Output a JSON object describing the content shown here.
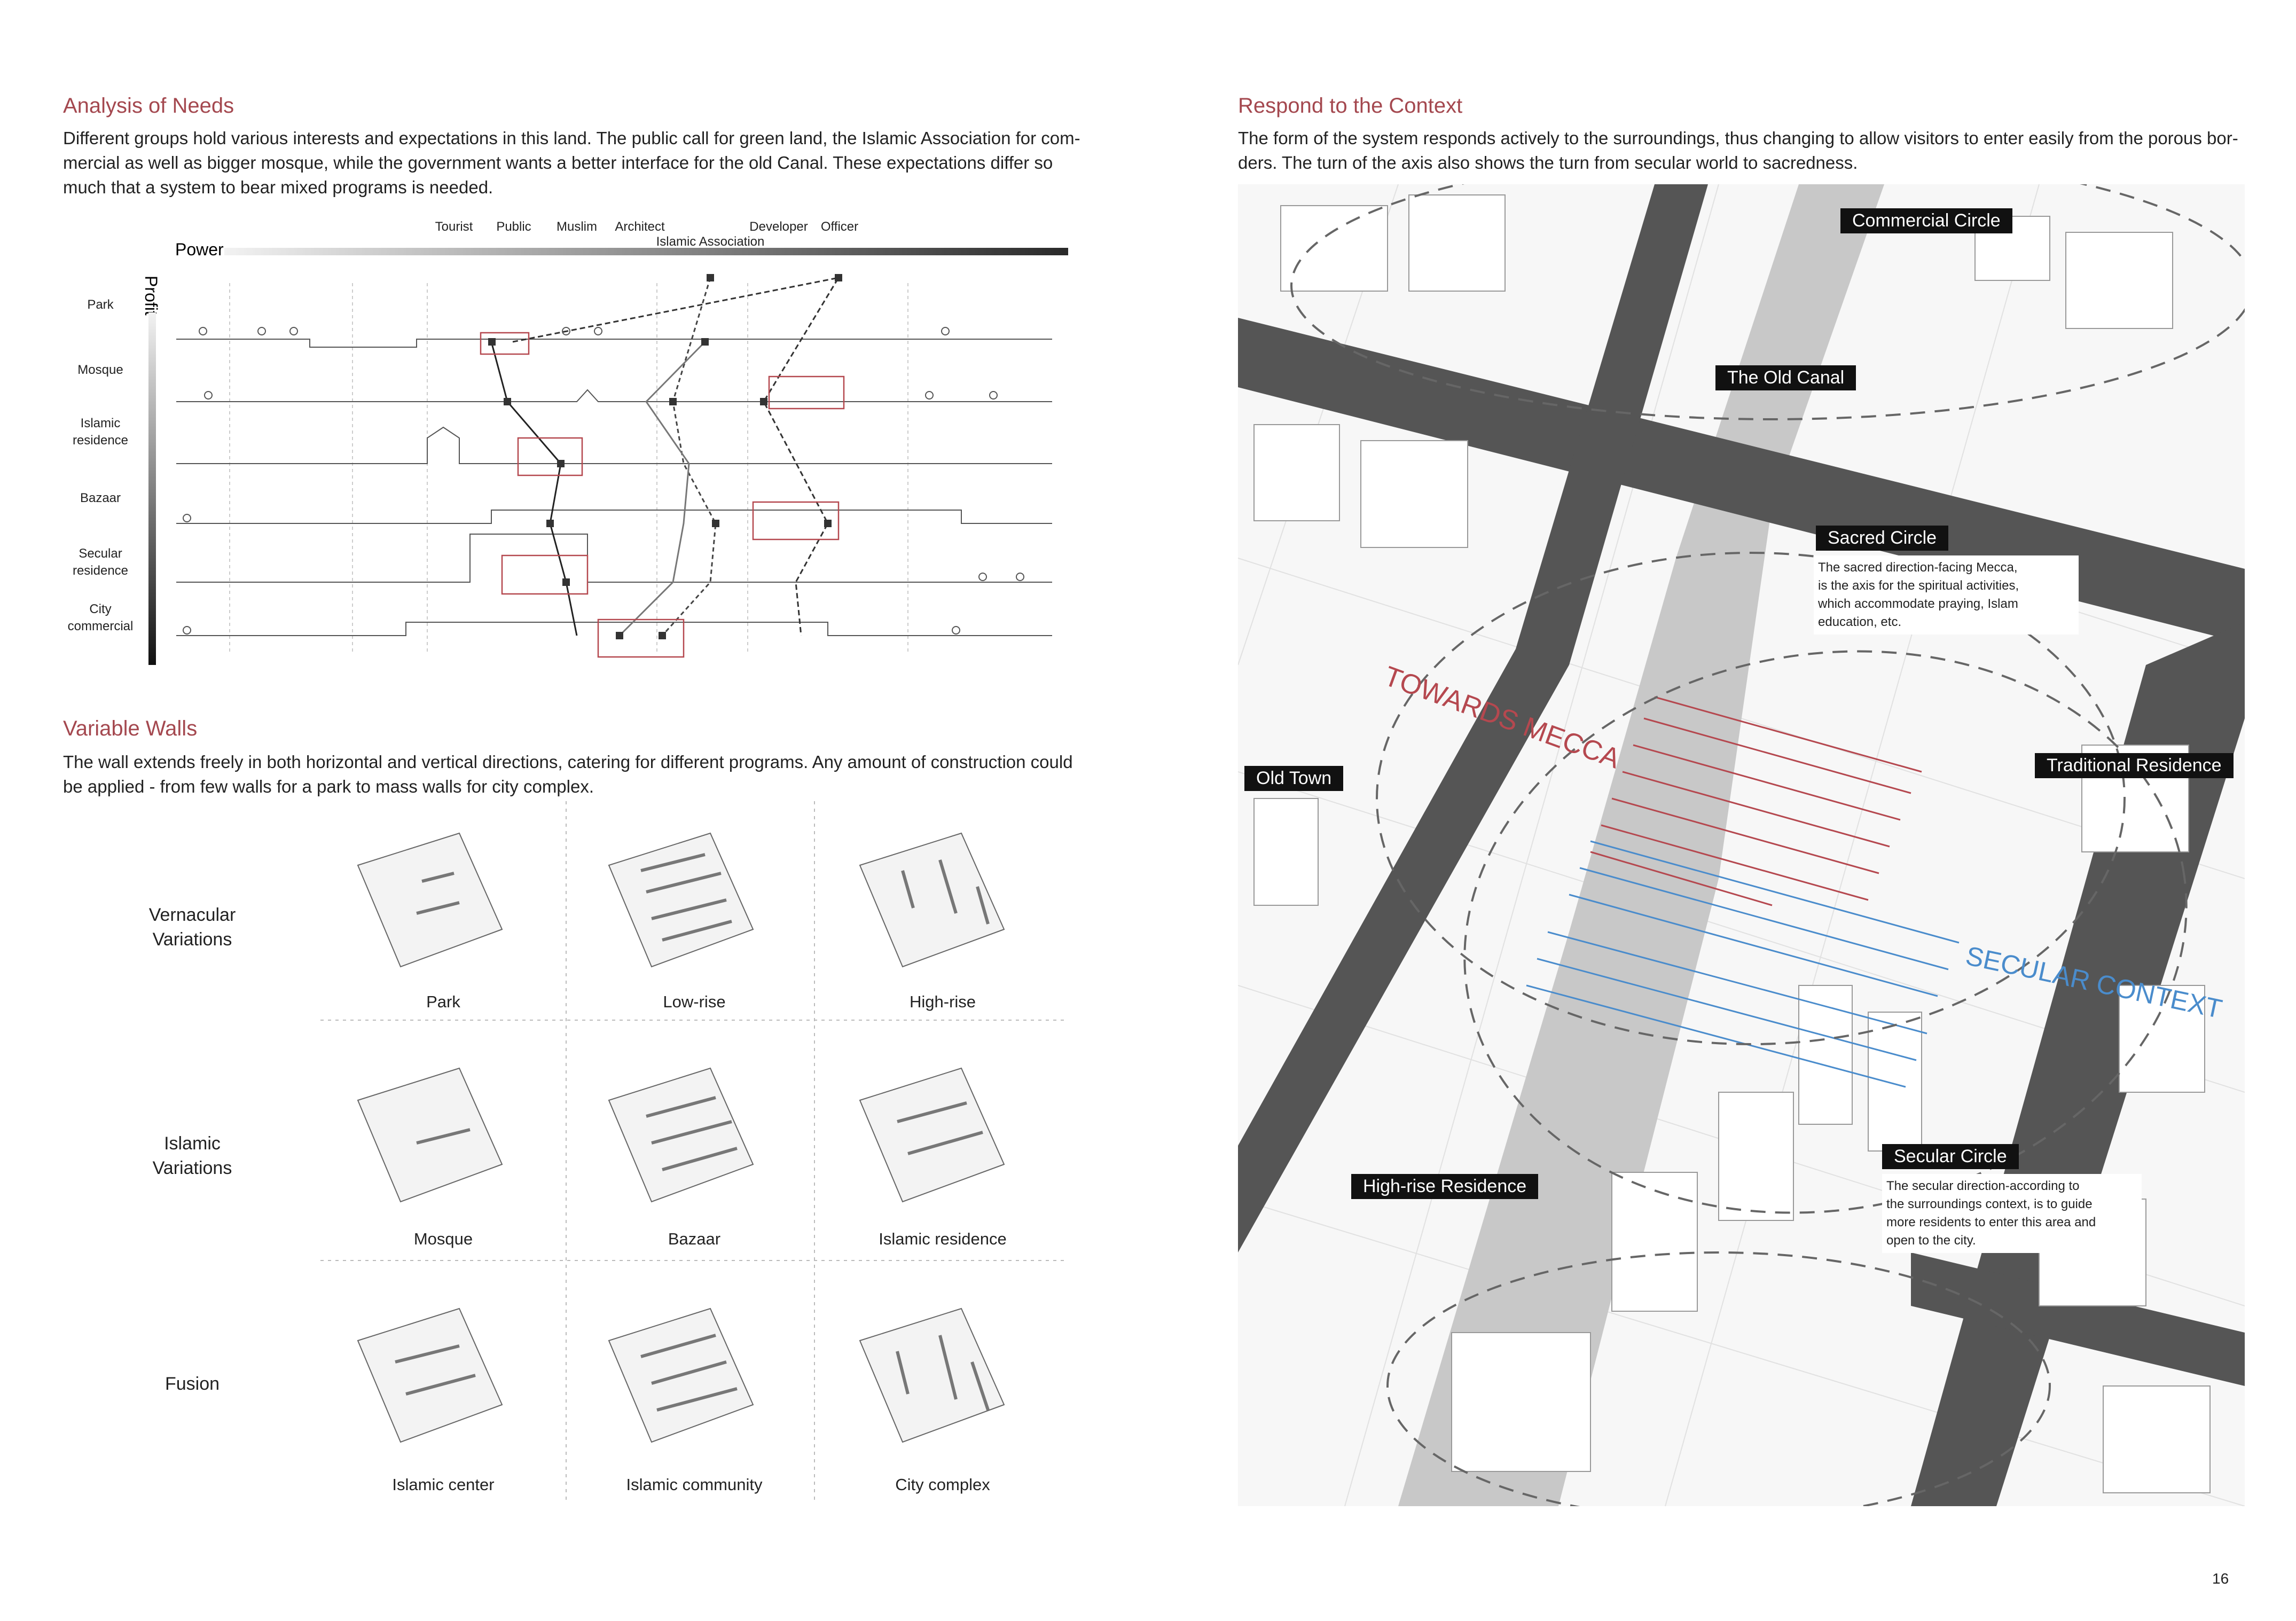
{
  "left": {
    "analysis": {
      "title": "Analysis of Needs",
      "lines": [
        "Different groups hold various interests and expectations in this land. The public call for green land, the Islamic Association for com-",
        "mercial as well as bigger mosque, while the government wants a better interface for the old Canal. These expectations differ so",
        "much that a system to bear mixed programs is needed."
      ]
    },
    "chart": {
      "power_label": "Power",
      "profit_label": "Profit",
      "stakeholders": [
        "Tourist",
        "Public",
        "Muslim",
        "Architect",
        "Islamic Association",
        "Developer",
        "Officer"
      ],
      "programs": [
        "Park",
        "Mosque",
        "Islamic residence",
        "Bazaar",
        "Secular residence",
        "City commercial"
      ]
    },
    "walls": {
      "title": "Variable Walls",
      "lines": [
        "The wall extends freely in both horizontal and vertical directions, catering for different programs. Any amount of construction could",
        "be applied - from few walls for a park to mass walls for city complex."
      ],
      "rows": [
        {
          "label": [
            "Vernacular",
            "Variations"
          ],
          "cells": [
            "Park",
            "Low-rise",
            "High-rise"
          ]
        },
        {
          "label": [
            "Islamic",
            "Variations"
          ],
          "cells": [
            "Mosque",
            "Bazaar",
            "Islamic residence"
          ]
        },
        {
          "label": [
            "Fusion"
          ],
          "cells": [
            "Islamic center",
            "Islamic community",
            "City complex"
          ]
        }
      ]
    }
  },
  "right": {
    "context": {
      "title": "Respond to the Context",
      "lines": [
        "The form of the system responds actively to the surroundings, thus changing to allow visitors to enter easily from the porous bor-",
        "ders. The turn of the axis also shows the turn from secular world to sacredness."
      ]
    },
    "map": {
      "tags": {
        "commercial_circle": "Commercial Circle",
        "old_canal": "The Old Canal",
        "sacred_circle": "Sacred Circle",
        "old_town": "Old Town",
        "traditional_residence": "Traditional Residence",
        "secular_circle": "Secular Circle",
        "high_rise": "High-rise Residence"
      },
      "towards_mecca": "TOWARDS MECCA",
      "secular_context": "SECULAR CONTEXT",
      "sacred_note": [
        "The sacred direction-facing Mecca,",
        "is the axis for the spiritual activities,",
        "which accommodate praying, Islam",
        "education, etc."
      ],
      "secular_note": [
        "The secular direction-according to",
        "the surroundings context, is to guide",
        "more residents to enter this area and",
        "open to the city."
      ]
    }
  },
  "page_number": "16",
  "colors": {
    "accent": "#a4484f",
    "sacred": "#b5484f",
    "secular": "#4a8ccc",
    "road": "#555555",
    "canal": "#c8c8c8"
  }
}
